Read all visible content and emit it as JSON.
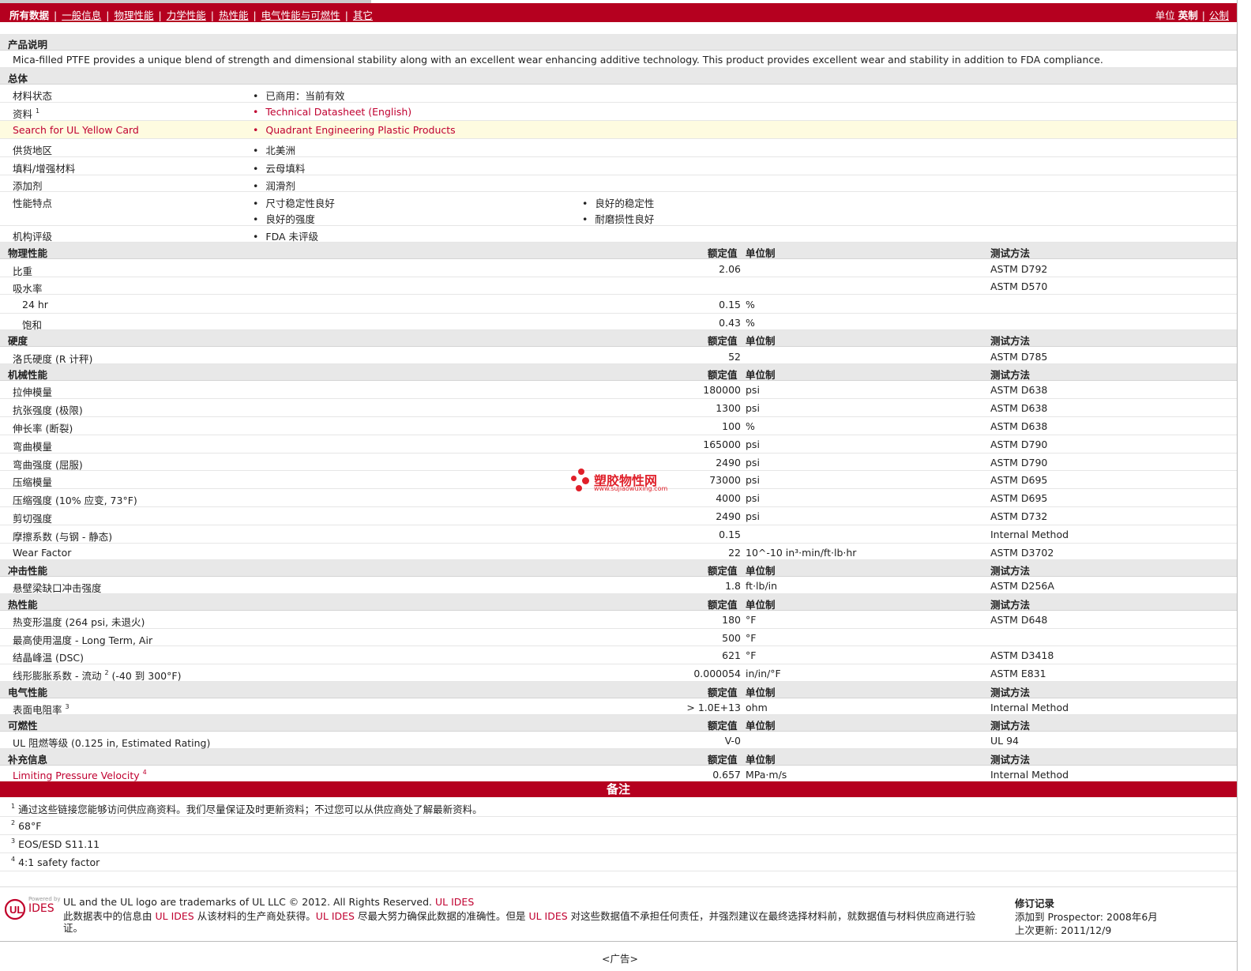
{
  "nav": {
    "items": [
      "所有数据",
      "一般信息",
      "物理性能",
      "力学性能",
      "热性能",
      "电气性能与可燃性",
      "其它"
    ],
    "separator": "|"
  },
  "units": {
    "label": "单位",
    "imperial": "英制",
    "metric": "公制",
    "separator": "|"
  },
  "description": {
    "header": "产品说明",
    "text": "Mica-filled PTFE provides a unique blend of strength and dimensional stability along with an excellent wear enhancing additive technology. This product provides excellent wear and stability in addition to FDA compliance."
  },
  "general": {
    "header": "总体",
    "status_label": "材料状态",
    "status_value": "已商用：当前有效",
    "docs_label": "资料",
    "docs_sup": "1",
    "docs_value": "Technical Datasheet (English)",
    "ul_label": "Search for UL Yellow Card",
    "ul_value": "Quadrant Engineering Plastic Products",
    "region_label": "供货地区",
    "region_value": "北美洲",
    "filler_label": "填料/增强材料",
    "filler_value": "云母填料",
    "additive_label": "添加剂",
    "additive_value": "润滑剂",
    "features_label": "性能特点",
    "features": [
      "尺寸稳定性良好",
      "良好的稳定性",
      "良好的强度",
      "耐磨损性良好"
    ],
    "agency_label": "机构评级",
    "agency_value": "FDA 未评级"
  },
  "col_headers": {
    "value": "额定值",
    "unit": "单位制",
    "test": "测试方法"
  },
  "physical": {
    "header": "物理性能",
    "rows": [
      {
        "label": "比重",
        "value": "2.06",
        "unit": "",
        "test": "ASTM D792"
      },
      {
        "label": "吸水率",
        "value": "",
        "unit": "",
        "test": "ASTM D570"
      },
      {
        "label": "24 hr",
        "value": "0.15",
        "unit": "%",
        "test": ""
      },
      {
        "label": "饱和",
        "value": "0.43",
        "unit": "%",
        "test": ""
      }
    ]
  },
  "hardness": {
    "header": "硬度",
    "rows": [
      {
        "label": "洛氏硬度 (R 计秤)",
        "value": "52",
        "unit": "",
        "test": "ASTM D785"
      }
    ]
  },
  "mechanical": {
    "header": "机械性能",
    "rows": [
      {
        "label": "拉伸模量",
        "value": "180000",
        "unit": "psi",
        "test": "ASTM D638"
      },
      {
        "label": "抗张强度 (极限)",
        "value": "1300",
        "unit": "psi",
        "test": "ASTM D638"
      },
      {
        "label": "伸长率 (断裂)",
        "value": "100",
        "unit": "%",
        "test": "ASTM D638"
      },
      {
        "label": "弯曲模量",
        "value": "165000",
        "unit": "psi",
        "test": "ASTM D790"
      },
      {
        "label": "弯曲强度 (屈服)",
        "value": "2490",
        "unit": "psi",
        "test": "ASTM D790"
      },
      {
        "label": "压缩模量",
        "value": "73000",
        "unit": "psi",
        "test": "ASTM D695"
      },
      {
        "label": "压缩强度 (10% 应变, 73°F)",
        "value": "4000",
        "unit": "psi",
        "test": "ASTM D695"
      },
      {
        "label": "剪切强度",
        "value": "2490",
        "unit": "psi",
        "test": "ASTM D732"
      },
      {
        "label": "摩擦系数 (与钢 - 静态)",
        "value": "0.15",
        "unit": "",
        "test": "Internal Method"
      },
      {
        "label": "Wear Factor",
        "value": "22",
        "unit": "10^-10 in³·min/ft·lb·hr",
        "test": "ASTM D3702"
      }
    ]
  },
  "impact": {
    "header": "冲击性能",
    "rows": [
      {
        "label": "悬壁梁缺口冲击强度",
        "value": "1.8",
        "unit": "ft·lb/in",
        "test": "ASTM D256A"
      }
    ]
  },
  "thermal": {
    "header": "热性能",
    "rows": [
      {
        "label": "热变形温度 (264 psi, 未退火)",
        "value": "180",
        "unit": "°F",
        "test": "ASTM D648"
      },
      {
        "label": "最高使用温度 - Long Term, Air",
        "value": "500",
        "unit": "°F",
        "test": ""
      },
      {
        "label": "结晶峰温 (DSC)",
        "value": "621",
        "unit": "°F",
        "test": "ASTM D3418"
      },
      {
        "label": "线形膨胀系数 - 流动",
        "sup": "2",
        "label_tail": "(-40 到 300°F)",
        "value": "0.000054",
        "unit": "in/in/°F",
        "test": "ASTM E831"
      }
    ]
  },
  "electrical": {
    "header": "电气性能",
    "rows": [
      {
        "label": "表面电阻率",
        "sup": "3",
        "value": "> 1.0E+13",
        "unit": "ohm",
        "test": "Internal Method"
      }
    ]
  },
  "flammability": {
    "header": "可燃性",
    "rows": [
      {
        "label": "UL 阻燃等级 (0.125 in, Estimated Rating)",
        "value": "V-0",
        "unit": "",
        "test": "UL 94"
      }
    ]
  },
  "supplemental": {
    "header": "补充信息",
    "rows": [
      {
        "label": "Limiting Pressure Velocity",
        "sup": "4",
        "value": "0.657",
        "unit": "MPa·m/s",
        "test": "Internal Method"
      }
    ]
  },
  "notes": {
    "header": "备注",
    "items": [
      {
        "num": "1",
        "text": "通过这些链接您能够访问供应商资料。我们尽量保证及时更新资料；不过您可以从供应商处了解最新资料。"
      },
      {
        "num": "2",
        "text": "68°F"
      },
      {
        "num": "3",
        "text": "EOS/ESD S11.11"
      },
      {
        "num": "4",
        "text": "4:1 safety factor"
      }
    ]
  },
  "watermark": {
    "text": "塑胶物性网",
    "sub": "www.sujiaowuxing.com"
  },
  "footer": {
    "powered_by": "Powered by",
    "logo_text": "IDES",
    "trademark": "UL and the UL logo are trademarks of UL LLC © 2012. All Rights Reserved.",
    "trademark_link": "UL IDES",
    "disclaimer_1": "此数据表中的信息由",
    "ul_ides": "UL IDES",
    "disclaimer_2": "从该材料的生产商处获得。",
    "disclaimer_3": "尽最大努力确保此数据的准确性。但是",
    "disclaimer_4": "对这些数据值不承担任何责任，并强烈建议在最终选择材料前，就数据值与材料供应商进行验",
    "disclaimer_5": "证。",
    "revision_title": "修订记录",
    "added_label": "添加到",
    "added_site": "Prospector:",
    "added_date": "2008年6月",
    "updated_label": "上次更新:",
    "updated_date": "2011/12/9"
  },
  "ad": "<广告>"
}
